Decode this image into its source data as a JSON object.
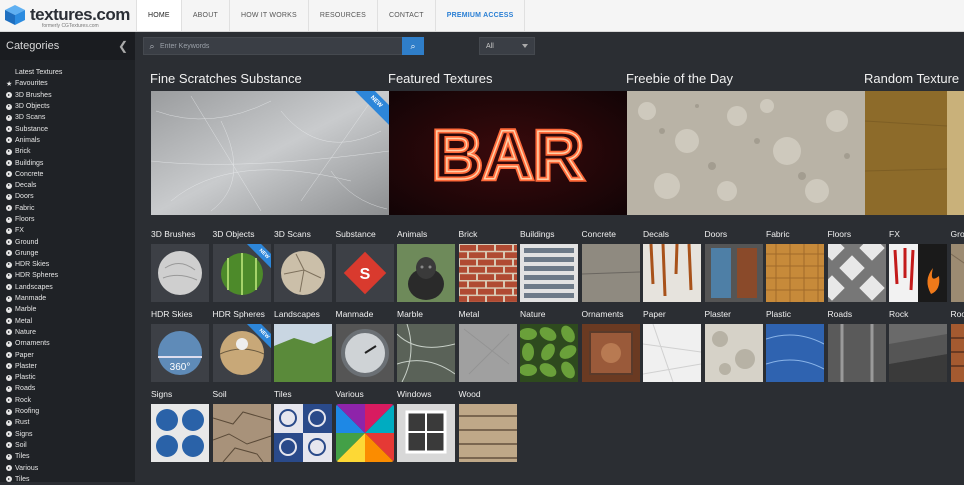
{
  "logo": {
    "name": "textures.com",
    "sub": "formerly CGTextures.com"
  },
  "nav": [
    {
      "label": "HOME",
      "active": true
    },
    {
      "label": "ABOUT"
    },
    {
      "label": "HOW IT WORKS"
    },
    {
      "label": "RESOURCES"
    },
    {
      "label": "CONTACT"
    },
    {
      "label": "PREMIUM ACCESS",
      "premium": true
    }
  ],
  "sidebar": {
    "title": "Categories",
    "items": [
      "Latest Textures",
      "Favourites",
      "3D Brushes",
      "3D Objects",
      "3D Scans",
      "Substance",
      "Animals",
      "Brick",
      "Buildings",
      "Concrete",
      "Decals",
      "Doors",
      "Fabric",
      "Floors",
      "FX",
      "Ground",
      "Grunge",
      "HDR Skies",
      "HDR Spheres",
      "Landscapes",
      "Manmade",
      "Marble",
      "Metal",
      "Nature",
      "Ornaments",
      "Paper",
      "Plaster",
      "Plastic",
      "Roads",
      "Rock",
      "Roofing",
      "Rust",
      "Signs",
      "Soil",
      "Tiles",
      "Various",
      "Tiles"
    ]
  },
  "search": {
    "placeholder": "Enter Keywords",
    "scope": "All"
  },
  "featured": [
    {
      "title": "Fine Scratches Substance",
      "badge": "NEW"
    },
    {
      "title": "Featured Textures",
      "image_text": "BAR"
    },
    {
      "title": "Freebie of the Day"
    },
    {
      "title": "Random Texture"
    }
  ],
  "grid": {
    "row1": [
      "3D Brushes",
      "3D Objects",
      "3D Scans",
      "Substance",
      "Animals",
      "Brick",
      "Buildings",
      "Concrete",
      "Decals",
      "Doors",
      "Fabric",
      "Floors",
      "FX",
      "Gro"
    ],
    "row2": [
      "HDR Skies",
      "HDR Spheres",
      "Landscapes",
      "Manmade",
      "Marble",
      "Metal",
      "Nature",
      "Ornaments",
      "Paper",
      "Plaster",
      "Plastic",
      "Roads",
      "Rock",
      "Roo"
    ],
    "row3": [
      "Signs",
      "Soil",
      "Tiles",
      "Various",
      "Windows",
      "Wood"
    ],
    "badge": "NEW",
    "hdr_value": "360°"
  },
  "colors": {
    "accent": "#2f7ec9",
    "bg": "#2b2e33",
    "sidebar": "#1f2226"
  }
}
